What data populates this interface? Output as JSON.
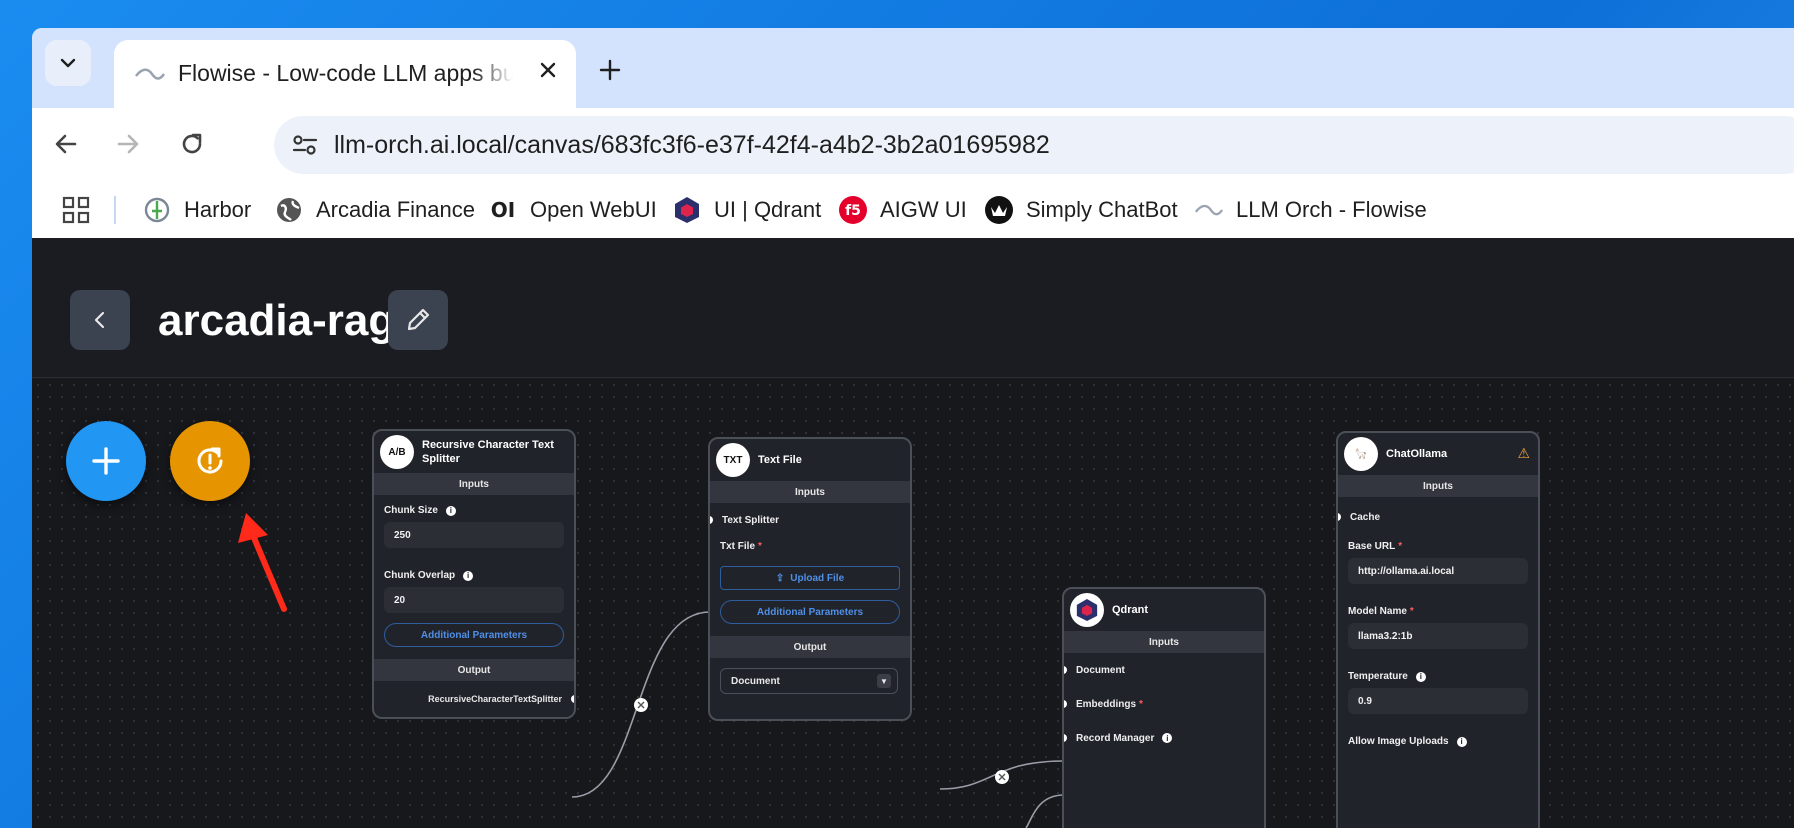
{
  "browser": {
    "tab": {
      "title": "Flowise - Low-code LLM apps builder"
    },
    "url": "llm-orch.ai.local/canvas/683fc3f6-e37f-42f4-a4b2-3b2a01695982",
    "bookmarks": [
      {
        "label": "Harbor",
        "icon": "harbor-icon"
      },
      {
        "label": "Arcadia Finance",
        "icon": "globe-icon"
      },
      {
        "label": "Open WebUI",
        "icon": "openwebui-icon"
      },
      {
        "label": "UI | Qdrant",
        "icon": "qdrant-icon"
      },
      {
        "label": "AIGW UI",
        "icon": "f5-icon"
      },
      {
        "label": "Simply ChatBot",
        "icon": "chatbot-icon"
      },
      {
        "label": "LLM Orch - Flowise",
        "icon": "flowise-icon"
      }
    ]
  },
  "app": {
    "flow_title": "arcadia-rag",
    "fab_colors": {
      "add": "#2196f3",
      "sync": "#e69500"
    }
  },
  "nodes": {
    "splitter": {
      "icon_text": "A/B",
      "title": "Recursive Character Text Splitter",
      "inputs_label": "Inputs",
      "chunk_size_label": "Chunk Size",
      "chunk_size_value": "250",
      "chunk_overlap_label": "Chunk Overlap",
      "chunk_overlap_value": "20",
      "additional_params": "Additional Parameters",
      "output_label": "Output",
      "output_value": "RecursiveCharacterTextSplitter"
    },
    "textfile": {
      "icon_text": "TXT",
      "title": "Text File",
      "inputs_label": "Inputs",
      "text_splitter_label": "Text Splitter",
      "txt_file_label": "Txt File",
      "upload_label": "Upload File",
      "additional_params": "Additional Parameters",
      "output_label": "Output",
      "output_select": "Document"
    },
    "qdrant": {
      "icon_text": "Q",
      "title": "Qdrant",
      "inputs_label": "Inputs",
      "document_label": "Document",
      "embeddings_label": "Embeddings",
      "record_manager_label": "Record Manager"
    },
    "chatollama": {
      "icon_text": "🦙",
      "title": "ChatOllama",
      "inputs_label": "Inputs",
      "cache_label": "Cache",
      "base_url_label": "Base URL",
      "base_url_value": "http://ollama.ai.local",
      "model_name_label": "Model Name",
      "model_name_value": "llama3.2:1b",
      "temperature_label": "Temperature",
      "temperature_value": "0.9",
      "allow_image_label": "Allow Image Uploads"
    }
  }
}
